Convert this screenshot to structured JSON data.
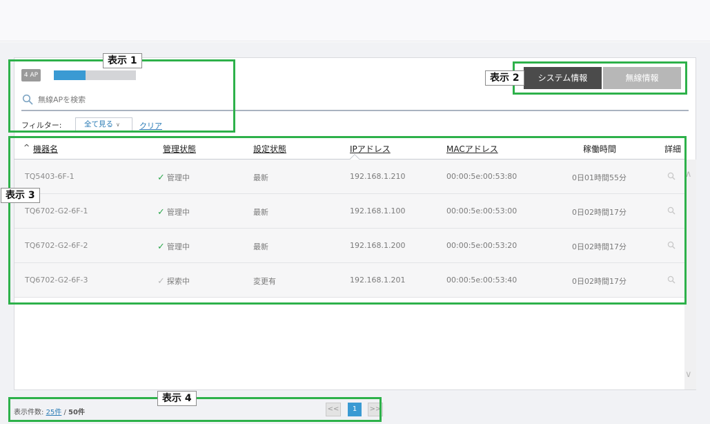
{
  "ap_summary": {
    "badge": "4 AP",
    "bar_fill_fraction": 0.39,
    "bar_color": "#3a9ad3"
  },
  "search": {
    "placeholder": "無線APを検索"
  },
  "filter": {
    "label": "フィルター:",
    "selected": "全て見る",
    "clear_label": "クリア"
  },
  "tabs": [
    {
      "label": "システム情報",
      "active": true
    },
    {
      "label": "無線情報",
      "active": false
    }
  ],
  "table": {
    "headers": {
      "sort_indicator": "^",
      "name": "機器名",
      "mgmt": "管理状態",
      "config": "設定状態",
      "ip": "IPアドレス",
      "mac": "MACアドレス",
      "uptime": "稼働時間",
      "detail": "詳細"
    },
    "rows": [
      {
        "name": "TQ5403-6F-1",
        "mgmt": "管理中",
        "mgmt_state": "managed",
        "config": "最新",
        "ip": "192.168.1.210",
        "mac": "00:00:5e:00:53:80",
        "uptime": "0日01時間55分"
      },
      {
        "name": "TQ6702-G2-6F-1",
        "mgmt": "管理中",
        "mgmt_state": "managed",
        "config": "最新",
        "ip": "192.168.1.100",
        "mac": "00:00:5e:00:53:00",
        "uptime": "0日02時間17分"
      },
      {
        "name": "TQ6702-G2-6F-2",
        "mgmt": "管理中",
        "mgmt_state": "managed",
        "config": "最新",
        "ip": "192.168.1.200",
        "mac": "00:00:5e:00:53:20",
        "uptime": "0日02時間17分"
      },
      {
        "name": "TQ6702-G2-6F-3",
        "mgmt": "探索中",
        "mgmt_state": "searching",
        "config": "変更有",
        "ip": "192.168.1.201",
        "mac": "00:00:5e:00:53:40",
        "uptime": "0日02時間17分"
      }
    ]
  },
  "footer": {
    "count_label": "表示件数:",
    "per_page": "25件",
    "separator": "/",
    "total": "50件",
    "prev": "<<",
    "page": "1",
    "next": ">>"
  },
  "annotations": [
    {
      "label": "表示 1"
    },
    {
      "label": "表示 2"
    },
    {
      "label": "表示 3"
    },
    {
      "label": "表示 4"
    }
  ],
  "colors": {
    "accent": "#3a9ad3",
    "annotation_green": "#2db14a",
    "status_managed": "#2fa84f",
    "status_searching": "#b9b9b9",
    "link": "#2a7bb5"
  }
}
